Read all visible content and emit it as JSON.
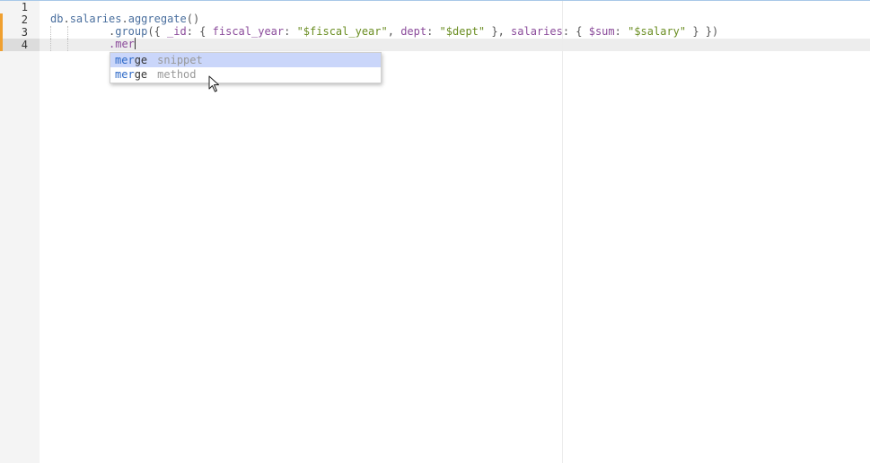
{
  "editor": {
    "gutter": {
      "line_numbers": [
        "1",
        "2",
        "3",
        "4"
      ]
    },
    "code": {
      "line2": {
        "db": "db",
        "dot1": ".",
        "salaries": "salaries",
        "dot2": ".",
        "aggregate": "aggregate",
        "parens": "()"
      },
      "line3": {
        "dot": ".",
        "group": "group",
        "open": "({ ",
        "id_key": "_id",
        "colon1": ": { ",
        "fiscal_year_key": "fiscal_year",
        "colon2": ": ",
        "fiscal_year_val": "\"$fiscal_year\"",
        "comma1": ", ",
        "dept_key": "dept",
        "colon3": ": ",
        "dept_val": "\"$dept\"",
        "close1": " }, ",
        "salaries_key": "salaries",
        "colon4": ": { ",
        "sum_key": "$sum",
        "colon5": ": ",
        "salary_val": "\"$salary\"",
        "close2": " } })"
      },
      "line4": {
        "typed": ".mer"
      }
    },
    "autocomplete": {
      "items": [
        {
          "match": "mer",
          "rest": "ge",
          "meta": "snippet",
          "selected": true
        },
        {
          "match": "mer",
          "rest": "ge",
          "meta": "method",
          "selected": false
        }
      ]
    }
  }
}
